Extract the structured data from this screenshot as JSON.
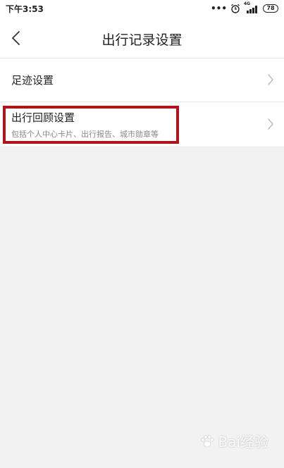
{
  "status_bar": {
    "time": "下午3:53",
    "dots": "•••",
    "network": "4G",
    "battery": "78"
  },
  "nav": {
    "title": "出行记录设置"
  },
  "settings": {
    "items": [
      {
        "title": "足迹设置"
      },
      {
        "title": "出行回顾设置",
        "subtitle": "包括个人中心卡片、出行报告、城市勋章等"
      }
    ]
  },
  "colors": {
    "highlight": "#b0141a",
    "background": "#f2f2f2"
  },
  "watermark": {
    "text": "Bai经验"
  }
}
